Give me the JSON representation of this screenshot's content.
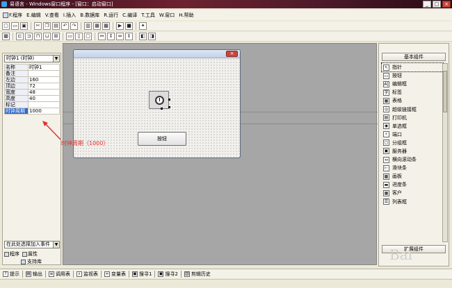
{
  "window": {
    "title": "易语言 - Windows窗口程序 - [窗口：启动窗口]",
    "controls": [
      "_",
      "□",
      "×"
    ]
  },
  "menu": [
    {
      "label": "F.程序"
    },
    {
      "label": "E.编辑"
    },
    {
      "label": "V.查看"
    },
    {
      "label": "I.插入"
    },
    {
      "label": "B.数据库"
    },
    {
      "label": "R.运行"
    },
    {
      "label": "C.编译"
    },
    {
      "label": "T.工具"
    },
    {
      "label": "W.窗口"
    },
    {
      "label": "H.帮助"
    }
  ],
  "left_panel": {
    "object_selector": "时钟1 (时钟)",
    "properties": [
      {
        "key": "名称",
        "value": "时钟1"
      },
      {
        "key": "备注",
        "value": ""
      },
      {
        "key": "左边",
        "value": "160"
      },
      {
        "key": "顶边",
        "value": "72"
      },
      {
        "key": "宽度",
        "value": "48"
      },
      {
        "key": "高度",
        "value": "40"
      },
      {
        "key": "标记",
        "value": ""
      },
      {
        "key": "时钟周期",
        "value": "1000"
      }
    ],
    "event_selector": "在此处选择加入事件",
    "tabs": [
      "程序",
      "属性"
    ],
    "support_lib": "支持库"
  },
  "designer": {
    "close_symbol": "×",
    "button_label": "按钮"
  },
  "annotation": {
    "text": "时钟周期（1000）",
    "color": "#e23131"
  },
  "right_panel": {
    "header": "基本组件",
    "components": [
      {
        "label": "指针",
        "icon": "pointer-icon",
        "glyph": "↖"
      },
      {
        "label": "按钮",
        "icon": "button-icon",
        "glyph": "▭"
      },
      {
        "label": "编辑框",
        "icon": "editbox-icon",
        "glyph": "A|"
      },
      {
        "label": "标签",
        "icon": "label-icon",
        "glyph": "字"
      },
      {
        "label": "表格",
        "icon": "table-icon",
        "glyph": "▦"
      },
      {
        "label": "超级链接框",
        "icon": "hyperlink-icon",
        "glyph": "◎"
      },
      {
        "label": "打印机",
        "icon": "printer-icon",
        "glyph": "▤"
      },
      {
        "label": "单选框",
        "icon": "radio-icon",
        "glyph": "◉"
      },
      {
        "label": "端口",
        "icon": "port-icon",
        "glyph": "⚡"
      },
      {
        "label": "分组框",
        "icon": "groupbox-icon",
        "glyph": "▢"
      },
      {
        "label": "服务器",
        "icon": "server-icon",
        "glyph": "▣"
      },
      {
        "label": "横向滚动条",
        "icon": "hscroll-icon",
        "glyph": "↔"
      },
      {
        "label": "滑块条",
        "icon": "slider-icon",
        "glyph": "⊢"
      },
      {
        "label": "画板",
        "icon": "canvas-icon",
        "glyph": "▩"
      },
      {
        "label": "进度条",
        "icon": "progress-icon",
        "glyph": "▬"
      },
      {
        "label": "客户",
        "icon": "client-icon",
        "glyph": "▦"
      },
      {
        "label": "列表框",
        "icon": "listbox-icon",
        "glyph": "☰"
      }
    ],
    "footer": "扩展组件"
  },
  "bottom_tabs": [
    {
      "label": "提示",
      "icon": "hint-icon",
      "glyph": "?"
    },
    {
      "label": "输出",
      "icon": "output-icon",
      "glyph": "▤"
    },
    {
      "label": "调用表",
      "icon": "calltable-icon",
      "glyph": "≡"
    },
    {
      "label": "监视表",
      "icon": "watch-icon",
      "glyph": "⌕"
    },
    {
      "label": "变量表",
      "icon": "variable-icon",
      "glyph": "∞"
    },
    {
      "label": "搜寻1",
      "icon": "search1-icon",
      "glyph": "▣"
    },
    {
      "label": "搜寻2",
      "icon": "search2-icon",
      "glyph": "▣"
    },
    {
      "label": "剪辑历史",
      "icon": "cliphistory-icon",
      "glyph": "▥"
    }
  ],
  "watermark": "Bai"
}
